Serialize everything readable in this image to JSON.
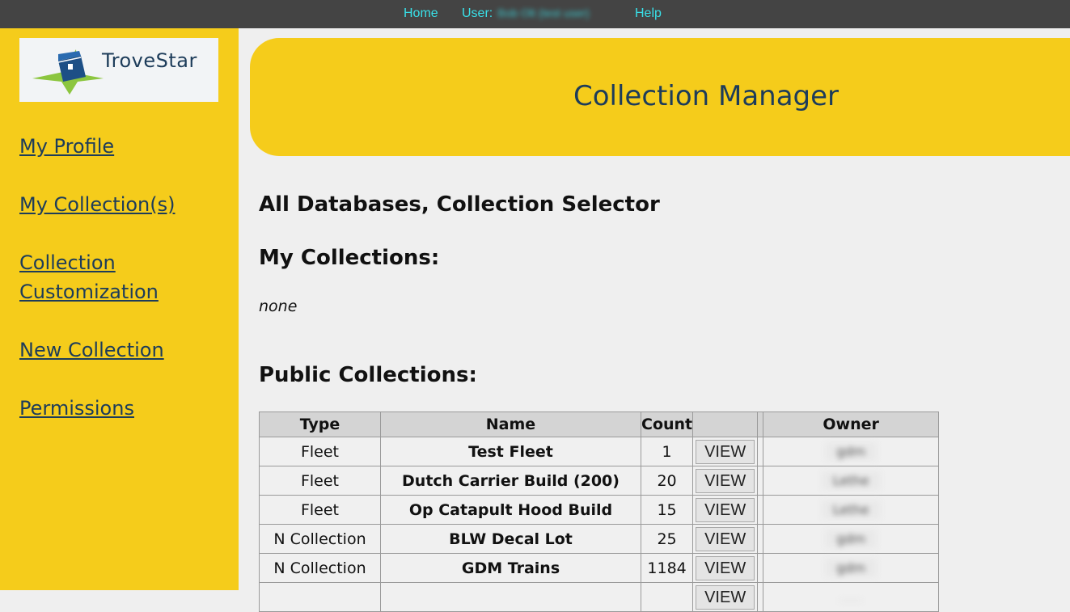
{
  "topbar": {
    "home": "Home",
    "user_label": "User:",
    "user_name": "Bob Olt (test user)",
    "help": "Help"
  },
  "logo": {
    "text": "TroveStar",
    "icon": "treasure-chest-star-icon"
  },
  "sidebar": {
    "items": [
      {
        "label": "My Profile"
      },
      {
        "label": "My Collection(s)"
      },
      {
        "label": "Collection Customization"
      },
      {
        "label": "New Collection"
      },
      {
        "label": "Permissions"
      }
    ]
  },
  "banner": {
    "title": "Collection Manager"
  },
  "main": {
    "heading": "All Databases, Collection Selector",
    "my_collections_heading": "My Collections:",
    "my_collections_empty": "none",
    "public_heading": "Public Collections:"
  },
  "table": {
    "headers": {
      "type": "Type",
      "name": "Name",
      "count": "Count",
      "view": "",
      "owner": "Owner"
    },
    "rows": [
      {
        "type": "Fleet",
        "name": "Test Fleet",
        "count": "1",
        "view": "VIEW",
        "owner": "gdm"
      },
      {
        "type": "Fleet",
        "name": "Dutch Carrier Build (200)",
        "count": "20",
        "view": "VIEW",
        "owner": "Lethe"
      },
      {
        "type": "Fleet",
        "name": "Op Catapult Hood Build",
        "count": "15",
        "view": "VIEW",
        "owner": "Lethe"
      },
      {
        "type": "N Collection",
        "name": "BLW Decal Lot",
        "count": "25",
        "view": "VIEW",
        "owner": "gdm"
      },
      {
        "type": "N Collection",
        "name": "GDM Trains",
        "count": "1184",
        "view": "VIEW",
        "owner": "gdm"
      },
      {
        "type": "",
        "name": "",
        "count": "",
        "view": "VIEW",
        "owner": ""
      }
    ]
  },
  "colors": {
    "accent_yellow": "#f5cc1b",
    "navy": "#1d3c5a",
    "topbar": "#444444",
    "nav_link": "#39e0e8"
  }
}
